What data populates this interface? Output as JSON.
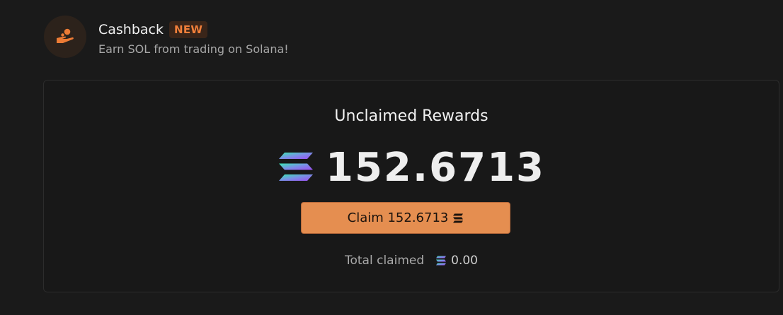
{
  "header": {
    "icon": "hand-coin-icon",
    "title": "Cashback",
    "badge": "NEW",
    "subtitle": "Earn SOL from trading on Solana!"
  },
  "rewards": {
    "title": "Unclaimed Rewards",
    "token_icon": "solana-icon",
    "amount": "152.6713",
    "claim_label": "Claim 152.6713",
    "total_label": "Total claimed",
    "total_value": "0.00"
  },
  "colors": {
    "accent": "#e58e50",
    "badge_text": "#f07f3a",
    "background": "#1a1a1a"
  }
}
